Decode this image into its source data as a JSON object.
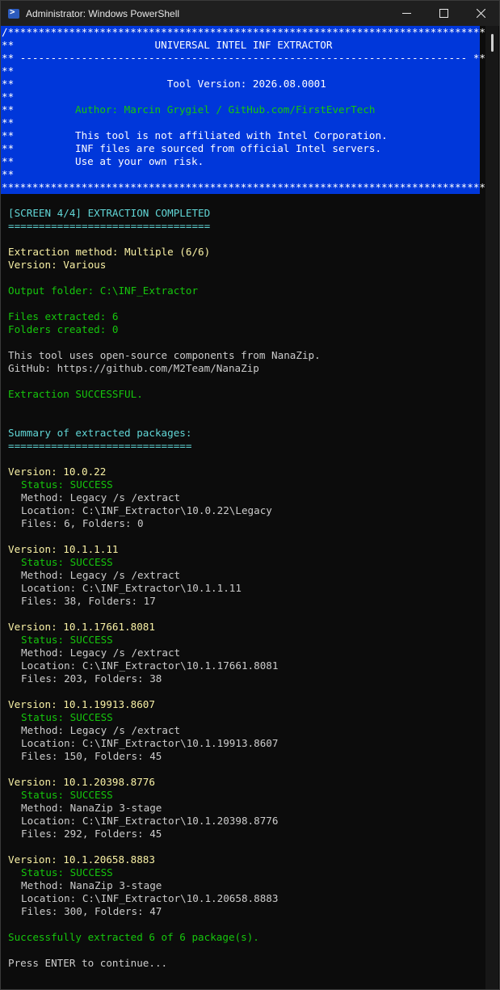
{
  "window": {
    "title": "Administrator: Windows PowerShell",
    "minimize": "—",
    "maximize": "☐",
    "close": "✕"
  },
  "banner": {
    "top_border": "/*******************************************************************************",
    "tool_name_line": "**                       UNIVERSAL INTEL INF EXTRACTOR                         **",
    "divider_line": "** ------------------------------------------------------------------------- **",
    "empty_line": "**                                                                             **",
    "version_line": "**                         Tool Version: 2026.08.0001                          **",
    "author_line": "**          Author: Marcin Grygiel / GitHub.com/FirstEverTech                  **",
    "disclaimer1": "**          This tool is not affiliated with Intel Corporation.                **",
    "disclaimer2": "**          INF files are sourced from official Intel servers.                 **",
    "disclaimer3": "**          Use at your own risk.                                              **",
    "bottom_border": "*******************************************************************************/"
  },
  "screen_header": {
    "title": "[SCREEN 4/4] EXTRACTION COMPLETED",
    "underline": "================================="
  },
  "extraction": {
    "method": "Extraction method: Multiple (6/6)",
    "version": "Version: Various",
    "output_folder": "Output folder: C:\\INF_Extractor",
    "files_extracted": "Files extracted: 6",
    "folders_created": "Folders created: 0",
    "nanazip_note": "This tool uses open-source components from NanaZip.",
    "nanazip_github": "GitHub: https://github.com/M2Team/NanaZip",
    "result": "Extraction SUCCESSFUL."
  },
  "summary": {
    "title": "Summary of extracted packages:",
    "underline": "==============================",
    "packages": [
      {
        "version": "Version: 10.0.22",
        "status": "Status: SUCCESS",
        "method": "Method: Legacy /s /extract",
        "location": "Location: C:\\INF_Extractor\\10.0.22\\Legacy",
        "files": "Files: 6, Folders: 0"
      },
      {
        "version": "Version: 10.1.1.11",
        "status": "Status: SUCCESS",
        "method": "Method: Legacy /s /extract",
        "location": "Location: C:\\INF_Extractor\\10.1.1.11",
        "files": "Files: 38, Folders: 17"
      },
      {
        "version": "Version: 10.1.17661.8081",
        "status": "Status: SUCCESS",
        "method": "Method: Legacy /s /extract",
        "location": "Location: C:\\INF_Extractor\\10.1.17661.8081",
        "files": "Files: 203, Folders: 38"
      },
      {
        "version": "Version: 10.1.19913.8607",
        "status": "Status: SUCCESS",
        "method": "Method: Legacy /s /extract",
        "location": "Location: C:\\INF_Extractor\\10.1.19913.8607",
        "files": "Files: 150, Folders: 45"
      },
      {
        "version": "Version: 10.1.20398.8776",
        "status": "Status: SUCCESS",
        "method": "Method: NanaZip 3-stage",
        "location": "Location: C:\\INF_Extractor\\10.1.20398.8776",
        "files": "Files: 292, Folders: 45"
      },
      {
        "version": "Version: 10.1.20658.8883",
        "status": "Status: SUCCESS",
        "method": "Method: NanaZip 3-stage",
        "location": "Location: C:\\INF_Extractor\\10.1.20658.8883",
        "files": "Files: 300, Folders: 47"
      }
    ],
    "final_message": "Successfully extracted 6 of 6 package(s).",
    "prompt": "Press ENTER to continue..."
  },
  "colors": {
    "banner_background": "#0037da",
    "console_background": "#0c0c0c",
    "cyan": "#61d6d6",
    "yellow": "#f9f1a5",
    "green": "#16c60c",
    "default_text": "#cccccc"
  }
}
